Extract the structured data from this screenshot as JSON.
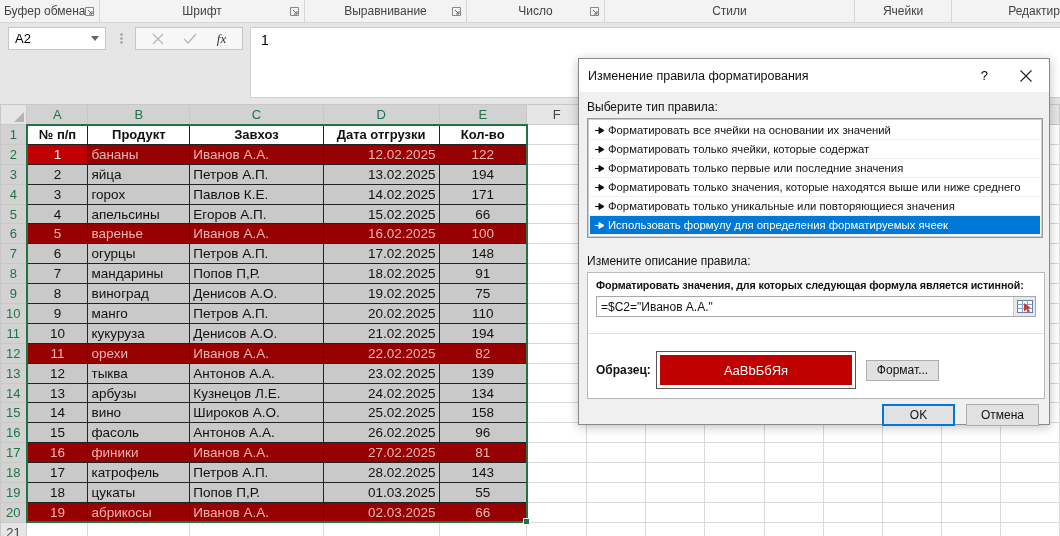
{
  "ribbon_groups": [
    {
      "label": "Буфер обмена",
      "launcher": true
    },
    {
      "label": "Шрифт",
      "launcher": true
    },
    {
      "label": "Выравнивание",
      "launcher": true
    },
    {
      "label": "Число",
      "launcher": true
    },
    {
      "label": "Стили",
      "launcher": false
    },
    {
      "label": "Ячейки",
      "launcher": false
    },
    {
      "label": "Редактир",
      "launcher": false
    }
  ],
  "formula_bar": {
    "name_box": "A2",
    "cancel_disabled": true,
    "enter_disabled": true,
    "function_label": "fx",
    "formula": "1"
  },
  "sheet": {
    "columns": [
      {
        "label": "A",
        "selected": true
      },
      {
        "label": "B",
        "selected": true
      },
      {
        "label": "C",
        "selected": true
      },
      {
        "label": "D",
        "selected": true
      },
      {
        "label": "E",
        "selected": true
      },
      {
        "label": "F",
        "selected": false
      }
    ],
    "rows": [
      {
        "header": "1",
        "selected": true,
        "kind": "heading",
        "active": false,
        "cells": [
          "№ п/п",
          "Продукт",
          "Завхоз",
          "Дата отгрузки",
          "Кол-во"
        ]
      },
      {
        "header": "2",
        "selected": true,
        "kind": "data",
        "active": true,
        "highlighted": true,
        "cells": [
          "1",
          "бананы",
          "Иванов А.А.",
          "12.02.2025",
          "122"
        ]
      },
      {
        "header": "3",
        "selected": true,
        "kind": "data",
        "active": false,
        "highlighted": false,
        "cells": [
          "2",
          "яйца",
          "Петров А.П.",
          "13.02.2025",
          "194"
        ]
      },
      {
        "header": "4",
        "selected": true,
        "kind": "data",
        "active": false,
        "highlighted": false,
        "cells": [
          "3",
          "горох",
          "Павлов К.Е.",
          "14.02.2025",
          "171"
        ]
      },
      {
        "header": "5",
        "selected": true,
        "kind": "data",
        "active": false,
        "highlighted": false,
        "cells": [
          "4",
          "апельсины",
          "Егоров А.П.",
          "15.02.2025",
          "66"
        ]
      },
      {
        "header": "6",
        "selected": true,
        "kind": "data",
        "active": false,
        "highlighted": true,
        "cells": [
          "5",
          "варенье",
          "Иванов А.А.",
          "16.02.2025",
          "100"
        ]
      },
      {
        "header": "7",
        "selected": true,
        "kind": "data",
        "active": false,
        "highlighted": false,
        "cells": [
          "6",
          "огурцы",
          "Петров А.П.",
          "17.02.2025",
          "148"
        ]
      },
      {
        "header": "8",
        "selected": true,
        "kind": "data",
        "active": false,
        "highlighted": false,
        "cells": [
          "7",
          "мандарины",
          "Попов П,Р.",
          "18.02.2025",
          "91"
        ]
      },
      {
        "header": "9",
        "selected": true,
        "kind": "data",
        "active": false,
        "highlighted": false,
        "cells": [
          "8",
          "виноград",
          "Денисов А.О.",
          "19.02.2025",
          "75"
        ]
      },
      {
        "header": "10",
        "selected": true,
        "kind": "data",
        "active": false,
        "highlighted": false,
        "cells": [
          "9",
          "манго",
          "Петров А.П.",
          "20.02.2025",
          "110"
        ]
      },
      {
        "header": "11",
        "selected": true,
        "kind": "data",
        "active": false,
        "highlighted": false,
        "cells": [
          "10",
          "кукуруза",
          "Денисов А.О.",
          "21.02.2025",
          "194"
        ]
      },
      {
        "header": "12",
        "selected": true,
        "kind": "data",
        "active": false,
        "highlighted": true,
        "cells": [
          "11",
          "орехи",
          "Иванов А.А.",
          "22.02.2025",
          "82"
        ]
      },
      {
        "header": "13",
        "selected": true,
        "kind": "data",
        "active": false,
        "highlighted": false,
        "cells": [
          "12",
          "тыква",
          "Антонов А.А.",
          "23.02.2025",
          "139"
        ]
      },
      {
        "header": "14",
        "selected": true,
        "kind": "data",
        "active": false,
        "highlighted": false,
        "cells": [
          "13",
          "арбузы",
          "Кузнецов Л.Е.",
          "24.02.2025",
          "134"
        ]
      },
      {
        "header": "15",
        "selected": true,
        "kind": "data",
        "active": false,
        "highlighted": false,
        "cells": [
          "14",
          "вино",
          "Широков А.О.",
          "25.02.2025",
          "158"
        ]
      },
      {
        "header": "16",
        "selected": true,
        "kind": "data",
        "active": false,
        "highlighted": false,
        "cells": [
          "15",
          "фасоль",
          "Антонов А.А.",
          "26.02.2025",
          "96"
        ]
      },
      {
        "header": "17",
        "selected": true,
        "kind": "data",
        "active": false,
        "highlighted": true,
        "cells": [
          "16",
          "финики",
          "Иванов А.А.",
          "27.02.2025",
          "81"
        ]
      },
      {
        "header": "18",
        "selected": true,
        "kind": "data",
        "active": false,
        "highlighted": false,
        "cells": [
          "17",
          "катрофель",
          "Петров А.П.",
          "28.02.2025",
          "143"
        ]
      },
      {
        "header": "19",
        "selected": true,
        "kind": "data",
        "active": false,
        "highlighted": false,
        "cells": [
          "18",
          "цукаты",
          "Попов П,Р.",
          "01.03.2025",
          "55"
        ]
      },
      {
        "header": "20",
        "selected": true,
        "kind": "data",
        "active": false,
        "highlighted": true,
        "cells": [
          "19",
          "абрикосы",
          "Иванов А.А.",
          "02.03.2025",
          "66"
        ]
      },
      {
        "header": "21",
        "selected": false,
        "kind": "empty"
      }
    ]
  },
  "dialog": {
    "title": "Изменение правила форматирования",
    "help": "?",
    "rule_type_label": "Выберите тип правила:",
    "rule_types": [
      {
        "label": "Форматировать все ячейки на основании их значений",
        "selected": false
      },
      {
        "label": "Форматировать только ячейки, которые содержат",
        "selected": false
      },
      {
        "label": "Форматировать только первые или последние значения",
        "selected": false
      },
      {
        "label": "Форматировать только значения, которые находятся выше или ниже среднего",
        "selected": false
      },
      {
        "label": "Форматировать только уникальные или повторяющиеся значения",
        "selected": false
      },
      {
        "label": "Использовать формулу для определения форматируемых ячеек",
        "selected": true
      }
    ],
    "description_label": "Измените описание правила:",
    "formula_label": "Форматировать значения, для которых следующая формула является истинной:",
    "formula": "=$C2=\"Иванов А.А.\"",
    "preview_label": "Образец:",
    "preview_text": "AaBbБбЯя",
    "format_button": "Формат...",
    "buttons": [
      {
        "label": "OK",
        "default": true
      },
      {
        "label": "Отмена",
        "default": false
      }
    ]
  }
}
